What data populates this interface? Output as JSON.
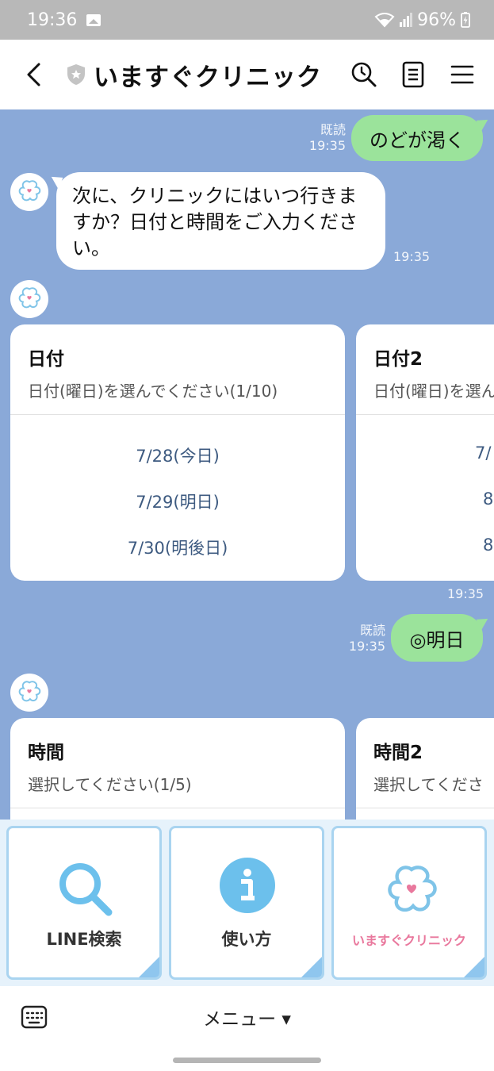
{
  "status_bar": {
    "time": "19:36",
    "battery": "96%"
  },
  "header": {
    "title": "いますぐクリニック"
  },
  "messages": {
    "m1": {
      "text": "のどが渇く",
      "read": "既読",
      "time": "19:35"
    },
    "m2": {
      "text": "次に、クリニックにはいつ行きますか？日付と時間をご入力ください。",
      "time": "19:35"
    },
    "m4": {
      "text": "◎明日",
      "read": "既読",
      "time": "19:35"
    }
  },
  "date_carousel": {
    "time": "19:35",
    "cards": [
      {
        "title": "日付",
        "subtitle": "日付(曜日)を選んでください(1/10)",
        "options": [
          "7/28(今日)",
          "7/29(明日)",
          "7/30(明後日)"
        ]
      },
      {
        "title": "日付2",
        "subtitle": "日付(曜日)を選ん",
        "options": [
          "7/",
          "8",
          "8"
        ]
      }
    ]
  },
  "time_carousel": {
    "cards": [
      {
        "title": "時間",
        "subtitle": "選択してください(1/5)"
      },
      {
        "title": "時間2",
        "subtitle": "選択してくださ"
      }
    ]
  },
  "rich_menu": {
    "tiles": [
      {
        "label": "LINE検索",
        "icon": "search-icon"
      },
      {
        "label": "使い方",
        "icon": "info-icon"
      },
      {
        "label": "いますぐクリニック",
        "icon": "clinic-logo"
      }
    ]
  },
  "bottom": {
    "menu_label": "メニュー ▾"
  },
  "colors": {
    "chat_bg": "#8aa9d8",
    "bubble_green": "#9be39b",
    "option_text": "#3d5a80",
    "brand_pink": "#e9789d",
    "brand_blue": "#7fc4e8"
  }
}
